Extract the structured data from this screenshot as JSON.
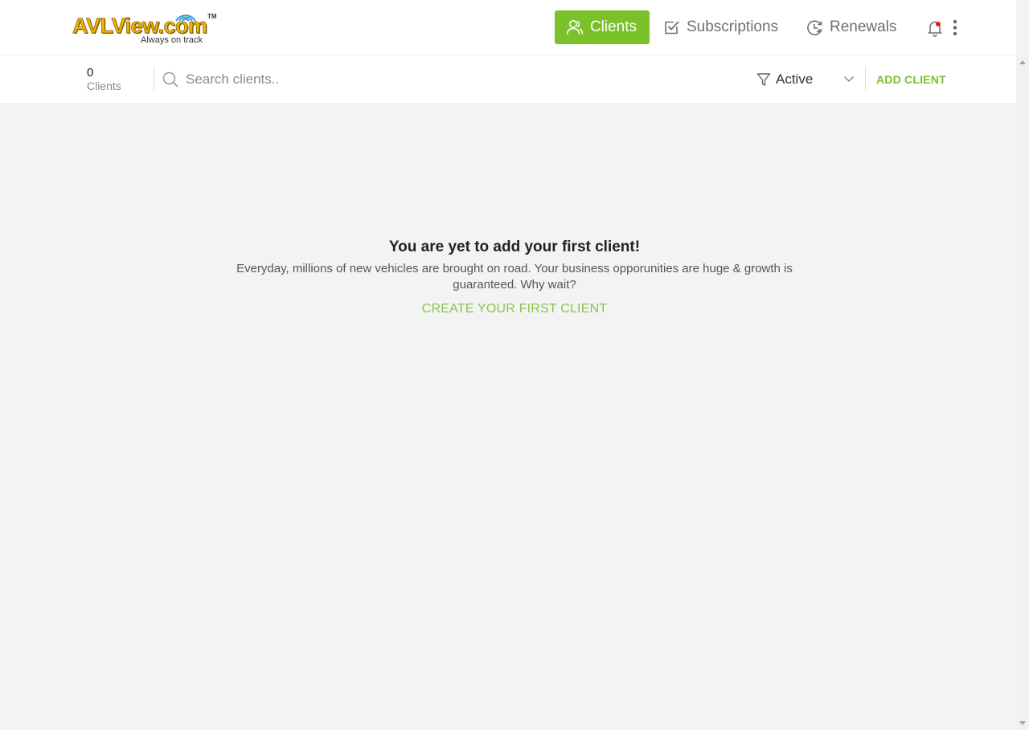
{
  "logo": {
    "brand": "AVLView.com",
    "trademark": "TM",
    "tagline": "Always on track"
  },
  "nav": {
    "clients": "Clients",
    "subscriptions": "Subscriptions",
    "renewals": "Renewals"
  },
  "toolbar": {
    "count": "0",
    "count_label": "Clients",
    "search_placeholder": "Search clients..",
    "filter_value": "Active",
    "add_client": "ADD CLIENT"
  },
  "empty_state": {
    "title": "You are yet to add your first client!",
    "text": "Everyday, millions of new vehicles are brought on road. Your business opporunities are huge & growth is guaranteed. Why wait?",
    "cta": "CREATE YOUR FIRST CLIENT"
  },
  "colors": {
    "accent": "#7ac12a",
    "background": "#f2f4f3",
    "notification_dot": "#e02020"
  },
  "icons": [
    "clients-icon",
    "subscriptions-icon",
    "renewals-icon",
    "bell-icon",
    "more-vert-icon",
    "search-icon",
    "filter-icon",
    "chevron-down-icon"
  ]
}
